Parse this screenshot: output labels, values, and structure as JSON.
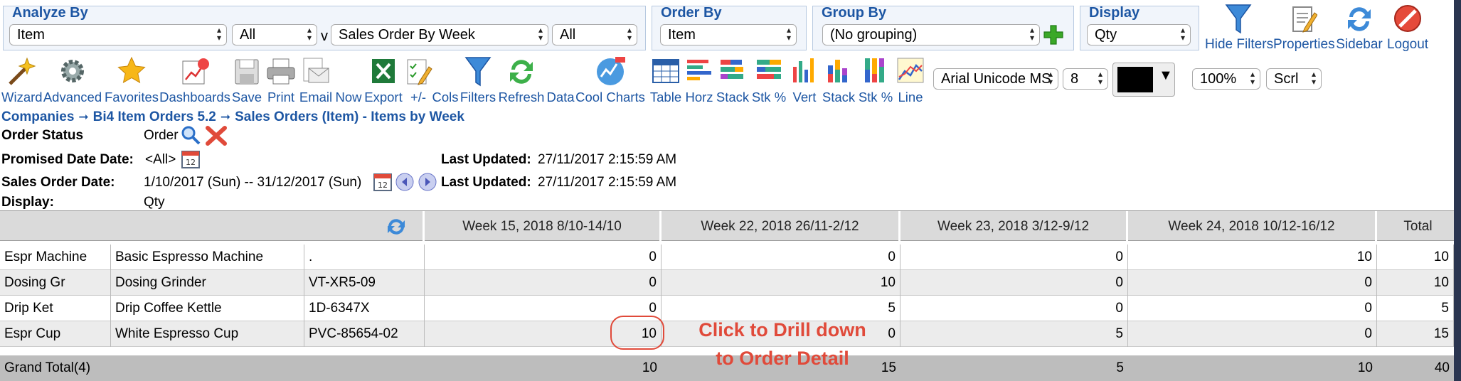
{
  "groups": {
    "analyze": {
      "title": "Analyze By",
      "item_select": "Item",
      "item_filter": "All",
      "v_glyph": "v",
      "report_select": "Sales Order By Week",
      "report_filter": "All"
    },
    "order": {
      "title": "Order By",
      "select": "Item"
    },
    "group": {
      "title": "Group By",
      "select": "(No grouping)"
    },
    "display": {
      "title": "Display",
      "select": "Qty"
    }
  },
  "header_buttons": [
    {
      "label": "Hide Filters",
      "icon": "filter-icon"
    },
    {
      "label": "Properties",
      "icon": "properties-icon"
    },
    {
      "label": "Sidebar",
      "icon": "refresh-icon"
    },
    {
      "label": "Logout",
      "icon": "logout-icon"
    }
  ],
  "toolbar": {
    "wizard": "Wizard",
    "advanced": "Advanced",
    "favorites": "Favorites",
    "dashboards": "Dashboards",
    "save": "Save",
    "print": "Print",
    "email": "Email",
    "now": "Now",
    "export": "Export",
    "plusminus": "+/-",
    "cols": "Cols",
    "filters": "Filters",
    "refresh": "Refresh",
    "data": "Data",
    "cool": "Cool Charts",
    "table": "Table",
    "horz": "Horz",
    "stack": "Stack",
    "stkpct": "Stk %",
    "vert": "Vert",
    "stack2": "Stack",
    "stkpct2": "Stk %",
    "line": "Line",
    "font": "Arial Unicode MS",
    "size": "8",
    "zoom": "100%",
    "scroll": "Scrl",
    "color": "#000000"
  },
  "breadcrumb": {
    "items": [
      "Companies",
      "Bi4 Item Orders 5.2",
      "Sales Orders (Item) - Items by Week"
    ],
    "sep": "➞"
  },
  "filters": {
    "order_status_label": "Order Status",
    "order_status_value": "Order",
    "promised_label": "Promised Date Date:",
    "promised_value": "<All>",
    "sales_label": "Sales Order Date:",
    "sales_value": "1/10/2017 (Sun) -- 31/12/2017 (Sun)",
    "display_label": "Display:",
    "display_value": "Qty",
    "last_updated_label": "Last Updated:",
    "last_updated_value": "27/11/2017 2:15:59 AM"
  },
  "table": {
    "columns": [
      "Week 15, 2018 8/10-14/10",
      "Week 22, 2018 26/11-2/12",
      "Week 23, 2018 3/12-9/12",
      "Week 24, 2018 10/12-16/12",
      "Total"
    ],
    "rows": [
      {
        "code": "Espr Machine",
        "desc": "Basic Espresso Machine",
        "sku": ".",
        "values": [
          "0",
          "0",
          "0",
          "10",
          "10"
        ]
      },
      {
        "code": "Dosing Gr",
        "desc": "Dosing Grinder",
        "sku": "VT-XR5-09",
        "values": [
          "0",
          "10",
          "0",
          "0",
          "10"
        ]
      },
      {
        "code": "Drip Ket",
        "desc": "Drip Coffee Kettle",
        "sku": "1D-6347X",
        "values": [
          "0",
          "5",
          "0",
          "0",
          "5"
        ]
      },
      {
        "code": "Espr Cup",
        "desc": "White Espresso Cup",
        "sku": "PVC-85654-02",
        "values": [
          "10",
          "0",
          "5",
          "0",
          "15"
        ]
      }
    ],
    "total_label": "Grand Total(4)",
    "totals": [
      "10",
      "15",
      "5",
      "10",
      "40"
    ]
  },
  "callout": {
    "line1": "Click to Drill down",
    "line2": "to Order Detail"
  },
  "colors": {
    "brand_blue": "#1d56a3",
    "callout_red": "#e04a3a",
    "header_grey": "#dadada",
    "total_grey": "#bdbdbd"
  }
}
